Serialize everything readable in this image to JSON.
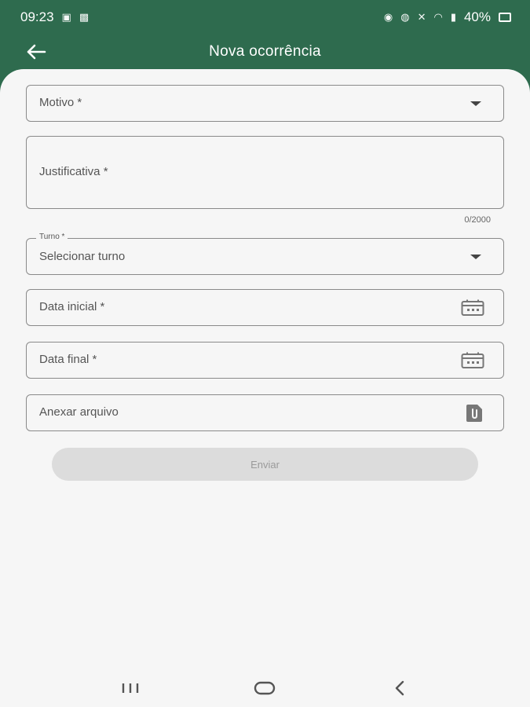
{
  "status_bar": {
    "time": "09:23",
    "battery": "40%",
    "left_icons": [
      "data-saver-icon",
      "gallery-icon"
    ],
    "right_icons": [
      "alarm-icon",
      "alarm-clock-icon",
      "mute-icon",
      "wifi-icon",
      "signal-icon",
      "battery-icon"
    ]
  },
  "app_bar": {
    "title": "Nova ocorrência",
    "back_icon": "arrow-left-icon"
  },
  "form": {
    "motivo": {
      "label": "Motivo *",
      "icon": "chevron-down-icon"
    },
    "justificativa": {
      "label": "Justificativa *",
      "counter": "0/2000"
    },
    "turno": {
      "floating_label": "Turno *",
      "value": "Selecionar turno",
      "icon": "chevron-down-icon"
    },
    "data_inicial": {
      "label": "Data inicial *",
      "icon": "calendar-icon"
    },
    "data_final": {
      "label": "Data final *",
      "icon": "calendar-icon"
    },
    "anexo": {
      "label": "Anexar arquivo",
      "icon": "attach-file-icon"
    },
    "submit_label": "Enviar"
  },
  "nav_bar": {
    "recent_icon": "recent-apps-icon",
    "home_icon": "home-icon",
    "back_icon": "back-icon"
  },
  "colors": {
    "primary": "#2e6b4e",
    "background": "#f6f6f6",
    "disabled_button": "#dcdcdc"
  }
}
